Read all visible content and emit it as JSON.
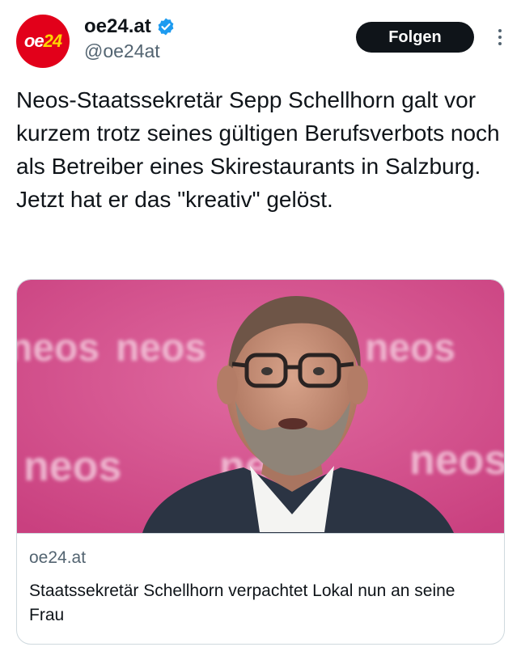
{
  "account": {
    "avatar_logo_text_prefix": "oe",
    "avatar_logo_text_number": "24",
    "display_name": "oe24.at",
    "handle": "@oe24at",
    "verified": true,
    "brand_color": "#e2001a",
    "verified_color": "#1d9bf0"
  },
  "actions": {
    "follow_label": "Folgen",
    "more_icon": "more-vertical-icon"
  },
  "tweet": {
    "text": "Neos-Staatssekretär Sepp Schellhorn galt vor kurzem trotz seines gültigen Berufsverbots noch als Betreiber eines Skirestaurants in Salzburg. Jetzt hat er das \"kreativ\" gelöst."
  },
  "link_card": {
    "image_backdrop_words": [
      "neos",
      "neos",
      "neos",
      "neos",
      "neos",
      "neos"
    ],
    "image_backdrop_color": "#d9508f",
    "domain": "oe24.at",
    "title": "Staatssekretär Schellhorn verpachtet Lokal nun an seine Frau"
  }
}
